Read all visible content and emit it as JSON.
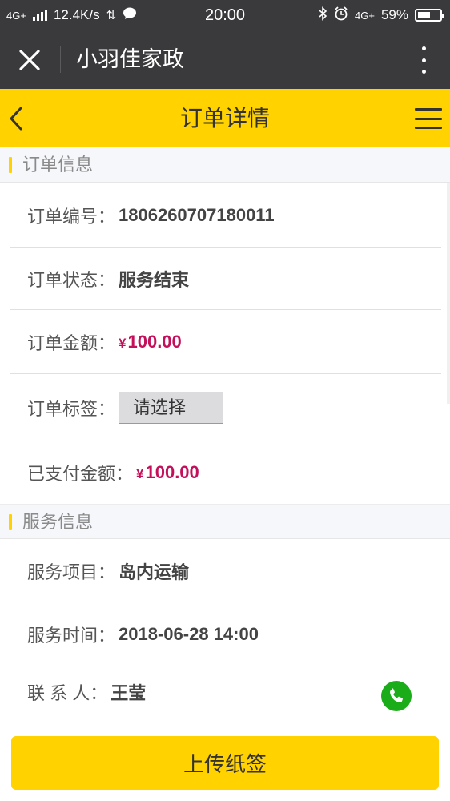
{
  "status_bar": {
    "network": "4G+",
    "speed": "12.4K/s",
    "time": "20:00",
    "network_right": "4G+",
    "battery_percent": "59%",
    "battery_level": 0.59
  },
  "wechat_header": {
    "title": "小羽佳家政"
  },
  "app_header": {
    "title": "订单详情"
  },
  "order_section": {
    "title": "订单信息",
    "rows": {
      "order_no": {
        "label": "订单编号：",
        "value": "1806260707180011"
      },
      "status": {
        "label": "订单状态：",
        "value": "服务结束"
      },
      "amount": {
        "label": "订单金额：",
        "currency": "¥",
        "value": "100.00"
      },
      "tag": {
        "label": "订单标签：",
        "select_value": "请选择"
      },
      "paid": {
        "label": "已支付金额：",
        "currency": "¥",
        "value": "100.00"
      }
    }
  },
  "service_section": {
    "title": "服务信息",
    "rows": {
      "item": {
        "label": "服务项目：",
        "value": "岛内运输"
      },
      "time": {
        "label": "服务时间：",
        "value": "2018-06-28 14:00"
      },
      "contact": {
        "label": "联 系 人：",
        "value": "王莹"
      }
    }
  },
  "bottom": {
    "upload_label": "上传纸签"
  },
  "colors": {
    "accent": "#ffd200",
    "price": "#c4105a",
    "phone": "#1aad19",
    "topbar": "#3a3a3c"
  },
  "icons": [
    "close-icon",
    "more-icon",
    "back-icon",
    "menu-icon",
    "phone-icon",
    "bluetooth-icon",
    "alarm-icon",
    "message-icon"
  ]
}
